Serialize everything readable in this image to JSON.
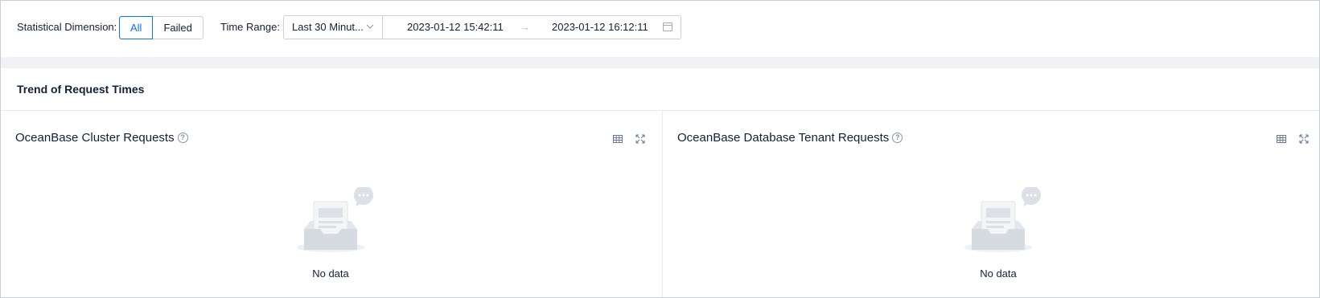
{
  "filters": {
    "dimension_label": "Statistical Dimension",
    "dimension_options": [
      "All",
      "Failed"
    ],
    "dimension_selected": "All",
    "time_range_label": "Time Range",
    "time_range_value": "Last 30 Minut...",
    "start_time": "2023-01-12 15:42:11",
    "end_time": "2023-01-12 16:12:11",
    "separator_glyph": "→"
  },
  "section": {
    "title": "Trend of Request Times"
  },
  "panels": [
    {
      "title": "OceanBase Cluster Requests",
      "empty_text": "No data"
    },
    {
      "title": "OceanBase Database Tenant Requests",
      "empty_text": "No data"
    }
  ],
  "colors": {
    "accent": "#0b6fff",
    "border": "#cdd0d6",
    "text": "#132039",
    "muted": "#8592ad",
    "band": "#f1f2f5"
  }
}
